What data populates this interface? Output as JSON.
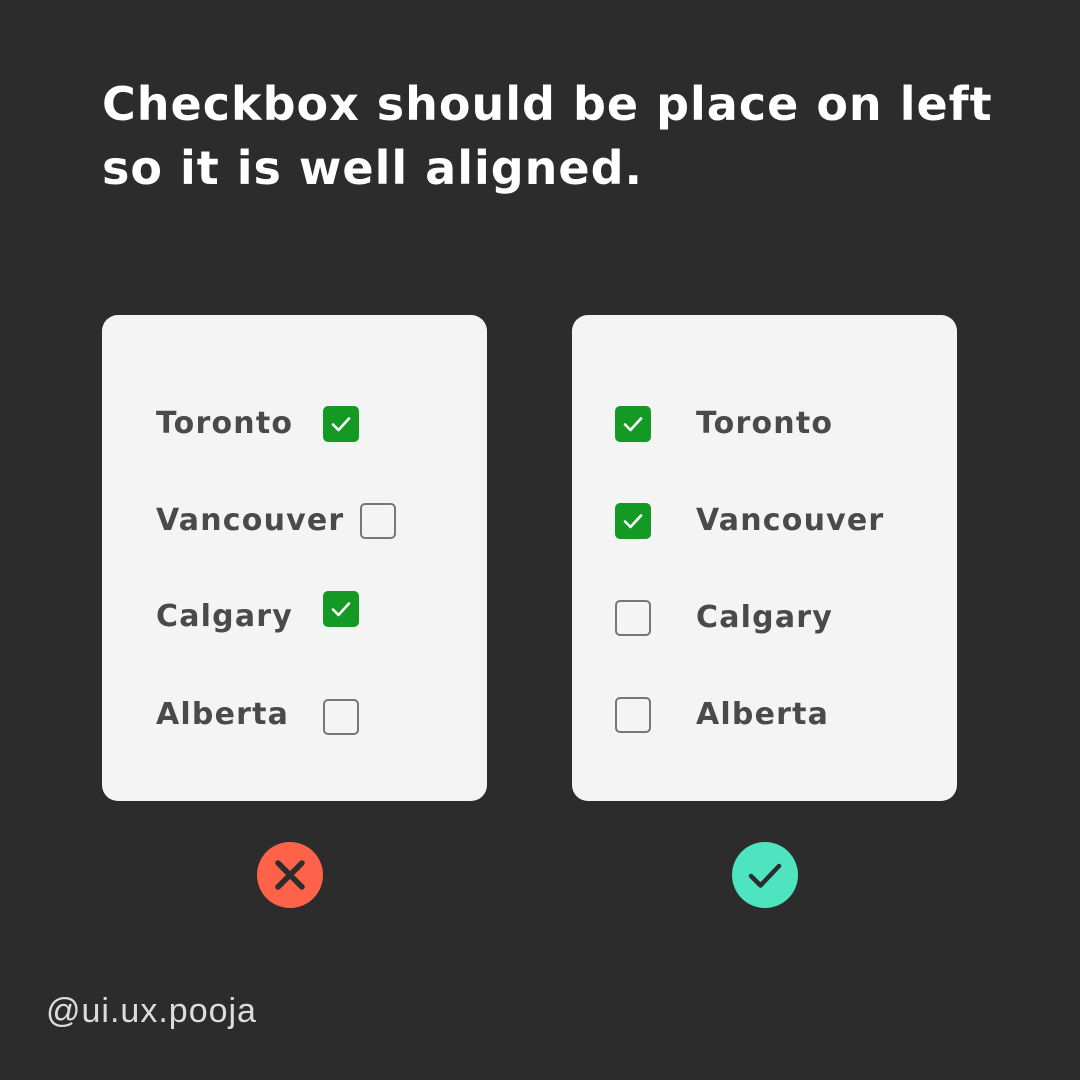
{
  "headline": {
    "line1": "Checkbox should be place on left",
    "line2": "so it is well aligned."
  },
  "bad_example": {
    "items": [
      {
        "label": "Toronto",
        "checked": true
      },
      {
        "label": "Vancouver",
        "checked": false
      },
      {
        "label": "Calgary",
        "checked": true
      },
      {
        "label": "Alberta",
        "checked": false
      }
    ],
    "verdict_icon": "cross-icon",
    "verdict_color": "#fe634a"
  },
  "good_example": {
    "items": [
      {
        "label": "Toronto",
        "checked": true
      },
      {
        "label": "Vancouver",
        "checked": true
      },
      {
        "label": "Calgary",
        "checked": false
      },
      {
        "label": "Alberta",
        "checked": false
      }
    ],
    "verdict_icon": "checkmark-icon",
    "verdict_color": "#4ee4c0"
  },
  "colors": {
    "background": "#2c2c2c",
    "card": "#f4f4f4",
    "checkbox_checked": "#149924",
    "checkbox_border": "#777777",
    "label_text": "#4a4a4a"
  },
  "watermark": "@ui.ux.pooja"
}
